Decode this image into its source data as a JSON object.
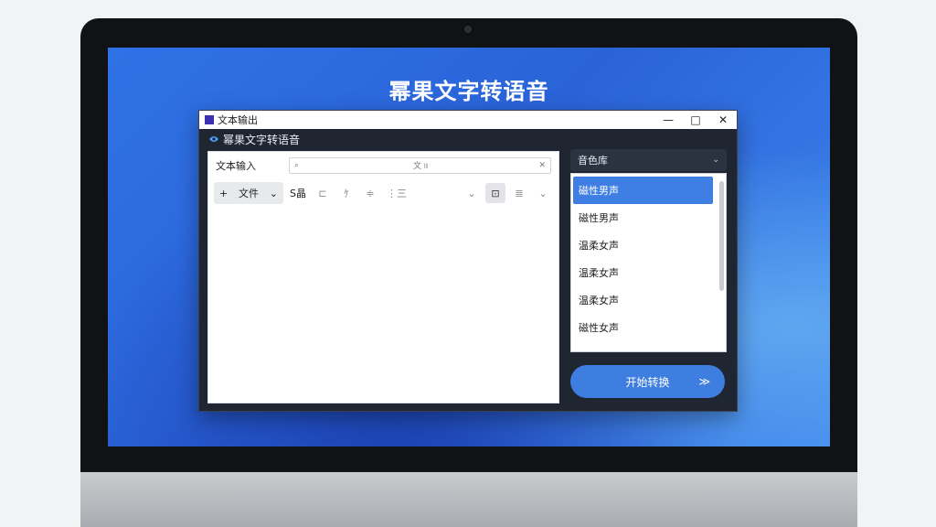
{
  "wallpaper": {
    "title": "幂果文字转语音"
  },
  "window": {
    "title": "文本输出",
    "controls": {
      "minimize": "—",
      "maximize": "□",
      "close": "✕"
    }
  },
  "app": {
    "header_title": "幂果文字转语音"
  },
  "text_panel": {
    "label": "文本输入",
    "search": {
      "icon": "search-icon",
      "text": "文 ৷৷৷",
      "clear": "✕"
    },
    "toolbar": {
      "file_button": "文件",
      "file_prefix": "+",
      "file_chevron": "⌄",
      "tools": [
        "S晶",
        "⊏",
        "ｹ",
        "≑",
        "⋮三"
      ],
      "dropdown": "⌄",
      "selected_tool": "⊡",
      "list_tool": "≣",
      "more": "⌄"
    },
    "content": ""
  },
  "voice_panel": {
    "select_label": "音色库",
    "select_chevron": "⌄",
    "items": [
      "磁性男声",
      "磁性男声",
      "温柔女声",
      "温柔女声",
      "温柔女声",
      "磁性女声"
    ],
    "active_index": 0
  },
  "start_button": {
    "label": "开始转换",
    "arrow": "≫"
  },
  "colors": {
    "accent": "#3f7ee2",
    "window_bg": "#1f2631",
    "wallpaper": "#2f72e6"
  }
}
